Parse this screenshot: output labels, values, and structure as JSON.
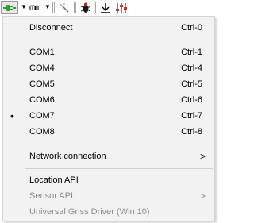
{
  "toolbar": {
    "buttons": [
      {
        "name": "connect-plug-icon",
        "color": "#2e9e3a"
      },
      {
        "name": "nmea-wave-icon",
        "label": "nm"
      },
      {
        "name": "magic-wand-icon"
      },
      {
        "name": "bug-icon"
      },
      {
        "name": "download-arrow-icon"
      },
      {
        "name": "sliders-icon",
        "color": "#c23b2a"
      }
    ]
  },
  "menu": {
    "disconnect": {
      "label": "Disconnect",
      "shortcut": "Ctrl-0"
    },
    "ports": [
      {
        "label": "COM1",
        "shortcut": "Ctrl-1",
        "selected": false
      },
      {
        "label": "COM4",
        "shortcut": "Ctrl-4",
        "selected": false
      },
      {
        "label": "COM5",
        "shortcut": "Ctrl-5",
        "selected": false
      },
      {
        "label": "COM6",
        "shortcut": "Ctrl-6",
        "selected": false
      },
      {
        "label": "COM7",
        "shortcut": "Ctrl-7",
        "selected": true
      },
      {
        "label": "COM8",
        "shortcut": "Ctrl-8",
        "selected": false
      }
    ],
    "bullet": "•",
    "network": {
      "label": "Network connection",
      "arrow": ">"
    },
    "location_api": {
      "label": "Location API"
    },
    "sensor_api": {
      "label": "Sensor API",
      "arrow": ">",
      "disabled": true
    },
    "gnss_driver": {
      "label": "Universal Gnss Driver (Win 10)",
      "disabled": true
    }
  }
}
